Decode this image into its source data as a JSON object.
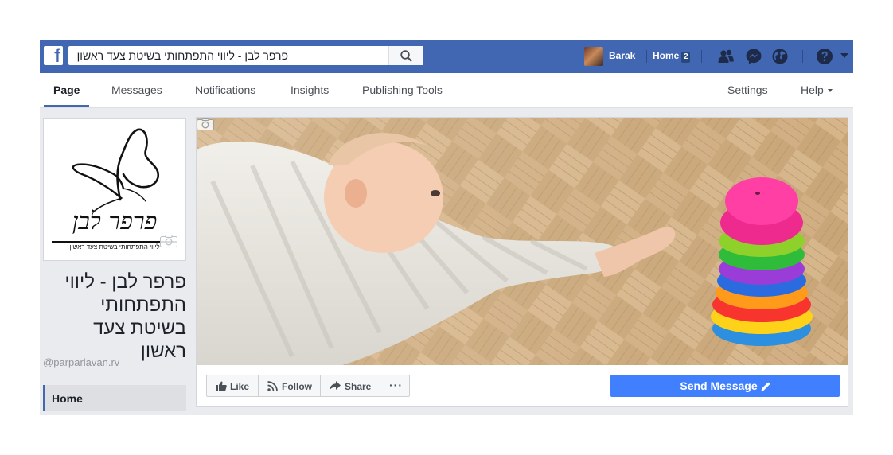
{
  "topbar": {
    "logo_letter": "f",
    "search_value": "פרפר לבן - ליווי התפתחותי בשיטת צעד ראשון",
    "user_name": "Barak",
    "home_label": "Home",
    "home_count": "2",
    "icons": [
      "facebook-logo-icon",
      "search-icon",
      "friends-icon",
      "messenger-icon",
      "globe-icon",
      "help-icon",
      "dropdown-arrow-icon"
    ],
    "brand_color": "#4267b2"
  },
  "tabs": {
    "page": "Page",
    "messages": "Messages",
    "notifications": "Notifications",
    "insights": "Insights",
    "publishing_tools": "Publishing Tools",
    "settings": "Settings",
    "help": "Help"
  },
  "profile": {
    "logo_text": "פרפר לבן",
    "logo_subtitle": "ליווי התפתחותי בשיטת צעד ראשון",
    "page_name": "פרפר לבן - ליווי התפתחותי בשיטת צעד ראשון",
    "handle": "@parparlavan.rv",
    "nav_home": "Home"
  },
  "actions": {
    "like": "Like",
    "follow": "Follow",
    "share": "Share",
    "more": "···",
    "send_message": "Send Message",
    "send_color": "#4080ff"
  }
}
